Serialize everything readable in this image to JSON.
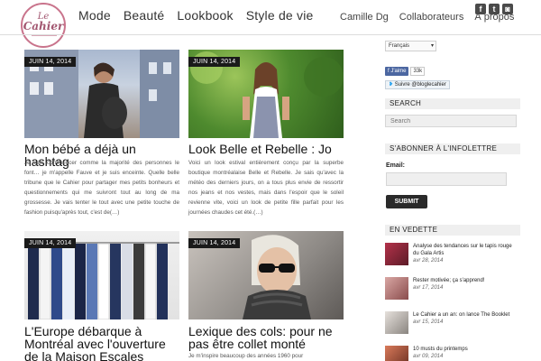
{
  "brand": {
    "logo_top": "Le",
    "logo_main": "Cahier"
  },
  "nav": {
    "main": [
      "Mode",
      "Beauté",
      "Lookbook",
      "Style de vie"
    ],
    "sub": [
      "Camille Dg",
      "Collaborateurs",
      "À propos"
    ]
  },
  "social": [
    {
      "icon": "facebook-icon",
      "glyph": "f"
    },
    {
      "icon": "twitter-icon",
      "glyph": "t"
    },
    {
      "icon": "instagram-icon",
      "glyph": "◙"
    }
  ],
  "posts": [
    {
      "date": "JUIN 14, 2014",
      "title": "Mon bébé a déjà un hashtag",
      "excerpt": "Je vais commencer comme la majorité des personnes le font… je m'appelle Fauve et je suis enceinte. Quelle belle tribune que le Cahier pour partager mes petits bonheurs et questionnements qui me suivront tout au long de ma grossesse. Je vais tenter le tout avec une petite touche de fashion puisqu'après tout, c'est de(…)"
    },
    {
      "date": "JUIN 14, 2014",
      "title": "Look Belle et Rebelle : Jo",
      "excerpt": "Voici un look estival entièrement conçu par la superbe boutique montréalaise Belle et Rebelle. Je sais qu'avec la météo des derniers jours, on a tous plus envie de ressortir nos jeans et nos vestes, mais dans l'espoir que le soleil revienne vite, voici un look de petite fille parfait pour les journées chaudes cet été.(…)"
    },
    {
      "date": "JUIN 14, 2014",
      "title": "L'Europe débarque à Montréal avec l'ouverture de la Maison Escales",
      "excerpt": ""
    },
    {
      "date": "JUIN 14, 2014",
      "title": "Lexique des cols: pour ne pas être collet monté",
      "excerpt": "Je m'inspire beaucoup des années 1960 pour"
    }
  ],
  "sidebar": {
    "language": "Français",
    "fb_like": "f J'aime",
    "fb_count": "33k",
    "twitter_follow": "Suivre @bloglecahier",
    "search_heading": "SEARCH",
    "search_placeholder": "Search",
    "newsletter_heading": "S'ABONNER À L'INFOLETTRE",
    "email_label": "Email:",
    "submit_label": "SUBMIT",
    "featured_heading": "EN VEDETTE",
    "featured": [
      {
        "title": "Analyse des tendances sur le tapis rouge du Gala Artis",
        "date": "avr 28, 2014"
      },
      {
        "title": "Rester motivée; ça s'apprend!",
        "date": "avr 17, 2014"
      },
      {
        "title": "Le Cahier a un an: on lance The Booklet",
        "date": "avr 15, 2014"
      },
      {
        "title": "10 musts du printemps",
        "date": "avr 09, 2014"
      }
    ]
  },
  "colors": {
    "accent": "#c9748c",
    "dark": "#1a1a1a",
    "panel": "#efefef"
  }
}
